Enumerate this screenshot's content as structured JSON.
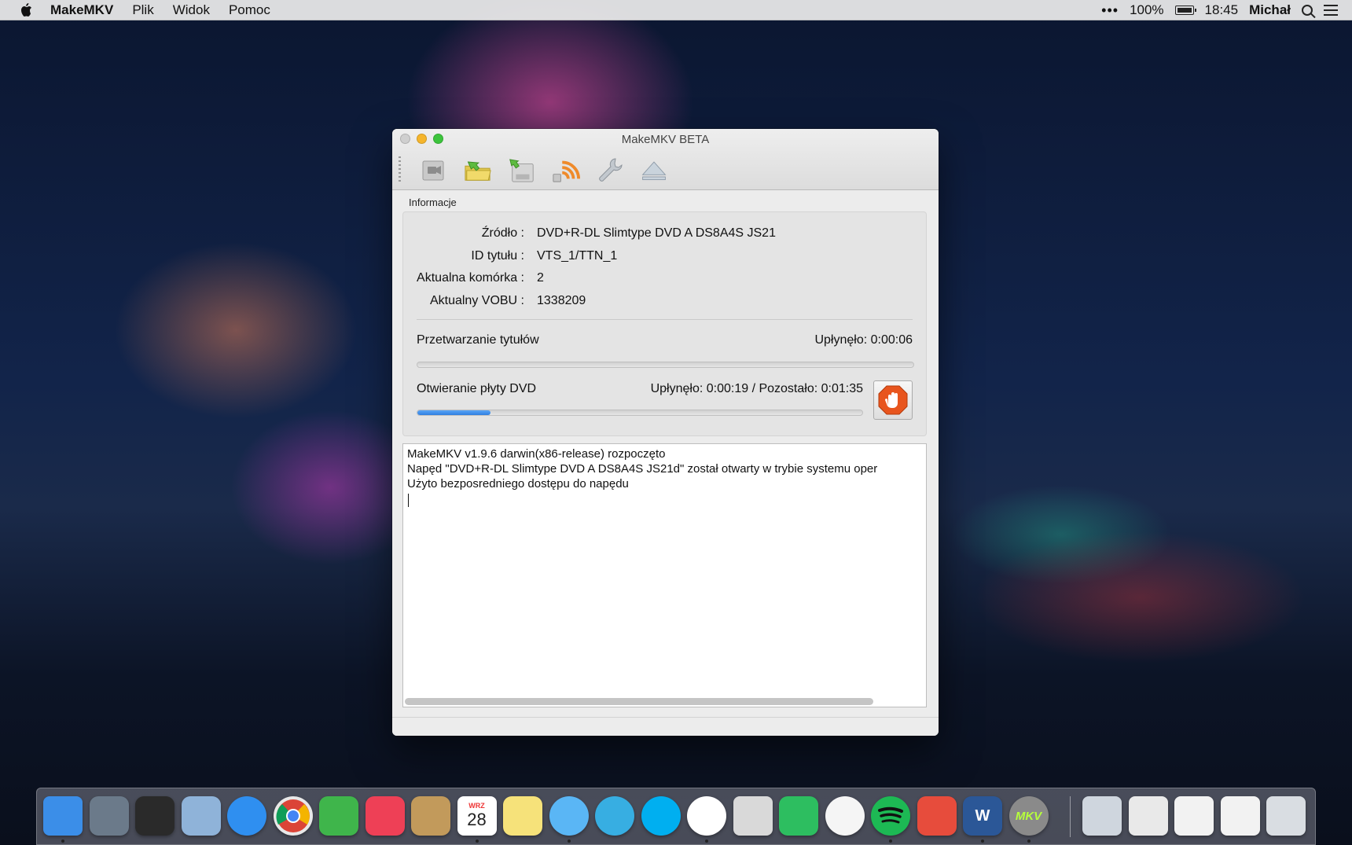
{
  "menubar": {
    "app_name": "MakeMKV",
    "menus": [
      "Plik",
      "Widok",
      "Pomoc"
    ],
    "battery": "100%",
    "time": "18:45",
    "user": "Michał"
  },
  "window": {
    "title": "MakeMKV BETA",
    "toolbar": [
      {
        "name": "open-files",
        "icon": "video-camera-icon"
      },
      {
        "name": "open-disc",
        "icon": "folder-arrow-icon"
      },
      {
        "name": "save",
        "icon": "save-disk-icon"
      },
      {
        "name": "stream",
        "icon": "rss-stream-icon"
      },
      {
        "name": "settings",
        "icon": "wrench-icon"
      },
      {
        "name": "eject",
        "icon": "eject-icon"
      }
    ],
    "section_label": "Informacje",
    "info": [
      {
        "label": "Źródło :",
        "value": "DVD+R-DL Slimtype DVD A DS8A4S JS21"
      },
      {
        "label": "ID tytułu :",
        "value": "VTS_1/TTN_1"
      },
      {
        "label": "Aktualna komórka :",
        "value": "2"
      },
      {
        "label": "Aktualny VOBU :",
        "value": "1338209"
      }
    ],
    "progress": [
      {
        "label": "Przetwarzanie tytułów",
        "time": "Upłynęło: 0:00:06",
        "fraction": 0.0
      },
      {
        "label": "Otwieranie płyty DVD",
        "time": "Upłynęło: 0:00:19 / Pozostało: 0:01:35",
        "fraction": 0.165
      }
    ],
    "log": [
      "MakeMKV v1.9.6 darwin(x86-release) rozpoczęto",
      "Napęd \"DVD+R-DL Slimtype DVD A DS8A4S JS21d\" został otwarty w trybie systemu oper",
      "Użyto bezposredniego dostępu do napędu"
    ]
  },
  "dock": {
    "calendar_month": "WRZ",
    "calendar_day": "28",
    "makemkv_label": "MKV",
    "word_label": "W",
    "apps": [
      {
        "name": "finder",
        "color": "#3b8ee8"
      },
      {
        "name": "launchpad",
        "color": "#6b7a8a"
      },
      {
        "name": "photo-booth",
        "color": "#2a2a2a"
      },
      {
        "name": "mail",
        "color": "#8fb3d9"
      },
      {
        "name": "safari",
        "color": "#2f8ff0"
      },
      {
        "name": "chrome",
        "color": "#e8e8e8"
      },
      {
        "name": "feedly",
        "color": "#3fb54b"
      },
      {
        "name": "pocket",
        "color": "#ee4056"
      },
      {
        "name": "contacts",
        "color": "#c29a5b"
      },
      {
        "name": "calendar",
        "color": "#ffffff"
      },
      {
        "name": "notes",
        "color": "#f6e27a"
      },
      {
        "name": "messages",
        "color": "#5ab6f5"
      },
      {
        "name": "telegram",
        "color": "#37aee2"
      },
      {
        "name": "skype",
        "color": "#00aff0"
      },
      {
        "name": "messenger",
        "color": "#ffffff"
      },
      {
        "name": "preview",
        "color": "#d9d9d9"
      },
      {
        "name": "evernote",
        "color": "#2dbe60"
      },
      {
        "name": "itunes",
        "color": "#f5f5f5"
      },
      {
        "name": "spotify",
        "color": "#1db954"
      },
      {
        "name": "transmit",
        "color": "#e74c3c"
      },
      {
        "name": "word",
        "color": "#2b5797"
      },
      {
        "name": "makemkv",
        "color": "#8a8a8a"
      },
      {
        "name": "folder",
        "color": "#cfd6de"
      },
      {
        "name": "documents-stack",
        "color": "#e9e9e9"
      },
      {
        "name": "downloads-stack",
        "color": "#f2f2f2"
      },
      {
        "name": "screenshots-stack",
        "color": "#f2f2f2"
      },
      {
        "name": "trash",
        "color": "#d9dde2"
      }
    ]
  }
}
